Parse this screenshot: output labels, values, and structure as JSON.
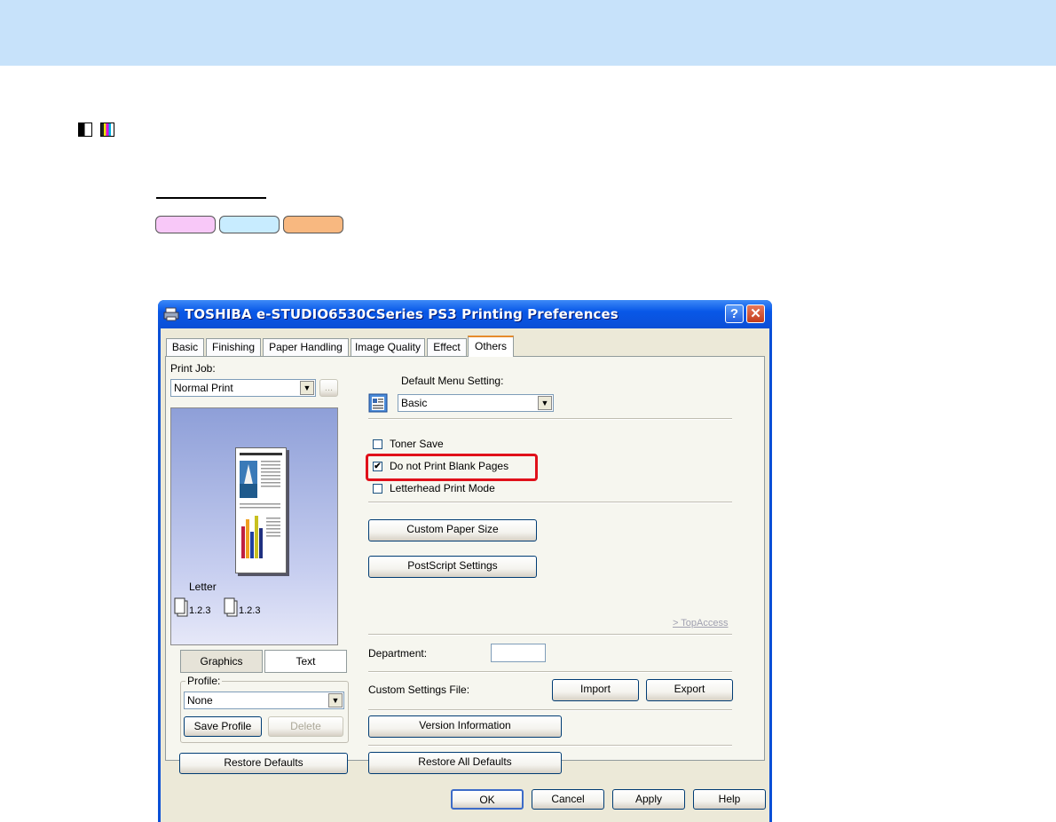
{
  "window": {
    "title": "TOSHIBA e-STUDIO6530CSeries PS3 Printing Preferences",
    "help_glyph": "?",
    "close_glyph": "✕"
  },
  "tabs": [
    {
      "label": "Basic"
    },
    {
      "label": "Finishing"
    },
    {
      "label": "Paper Handling"
    },
    {
      "label": "Image Quality"
    },
    {
      "label": "Effect"
    },
    {
      "label": "Others",
      "active": true
    }
  ],
  "left": {
    "print_job_label": "Print Job:",
    "print_job_value": "Normal Print",
    "print_job_button": "...",
    "preview_paper": "Letter",
    "preview_order_1": "1.2.3",
    "preview_order_2": "1.2.3",
    "view_graphics": "Graphics",
    "view_text": "Text",
    "profile_label": "Profile:",
    "profile_value": "None",
    "save_profile": "Save Profile",
    "delete": "Delete",
    "restore_defaults": "Restore Defaults"
  },
  "right": {
    "default_menu_label": "Default Menu Setting:",
    "default_menu_value": "Basic",
    "toner_save": {
      "label": "Toner Save",
      "checked": false
    },
    "no_blank_pages": {
      "label": "Do not Print Blank Pages",
      "checked": true
    },
    "letterhead": {
      "label": "Letterhead Print Mode",
      "checked": false
    },
    "custom_paper_size": "Custom Paper Size",
    "postscript_settings": "PostScript Settings",
    "topaccess_link": "> TopAccess",
    "department_label": "Department:",
    "department_value": "",
    "custom_settings_label": "Custom Settings File:",
    "import": "Import",
    "export": "Export",
    "version_info": "Version Information",
    "restore_all_defaults": "Restore All Defaults"
  },
  "footer": {
    "ok": "OK",
    "cancel": "Cancel",
    "apply": "Apply",
    "help": "Help"
  },
  "colors": {
    "banner": "#c7e2fa",
    "highlight": "#e0101a",
    "pill_pink": "#f8c8f8",
    "pill_blue": "#c8ecff",
    "pill_orange": "#f8b880"
  }
}
